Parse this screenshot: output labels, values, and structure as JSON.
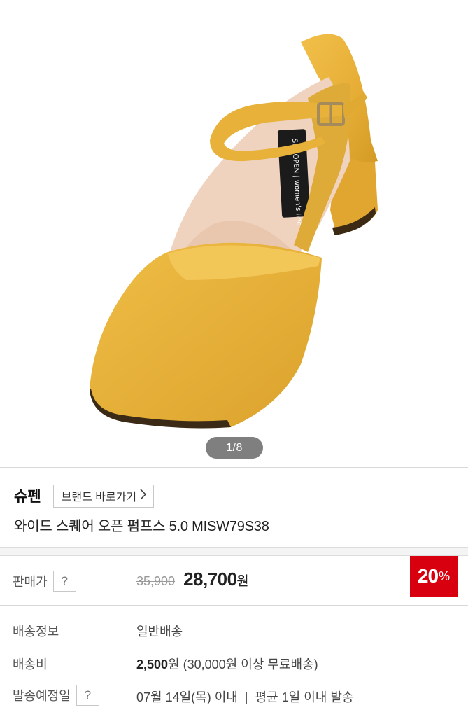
{
  "gallery": {
    "current": "1",
    "total": "/8",
    "image_label": "SHOOPEN | women's line"
  },
  "brand": {
    "name": "슈펜",
    "shortcut_label": "브랜드 바로가기",
    "shortcut_icon": "chevron-right-icon"
  },
  "product": {
    "name": "와이드 스퀘어 오픈 펌프스 5.0 MISW79S38"
  },
  "price": {
    "label": "판매가",
    "help": "?",
    "original": "35,900",
    "sale": "28,700",
    "unit": "원",
    "discount": "20",
    "discount_unit": "%"
  },
  "shipping": {
    "info_label": "배송정보",
    "info_value": "일반배송",
    "fee_label": "배송비",
    "fee_amount": "2,500",
    "fee_unit": "원",
    "fee_note": " (30,000원 이상 무료배송)",
    "eta_label": "발송예정일",
    "eta_help": "?",
    "eta_date": "07월 14일(목) 이내",
    "eta_sep": "|",
    "eta_avg": "평균 1일 이내 발송"
  },
  "colors": {
    "shoe": "#E8B23A",
    "discount_badge": "#D8000F"
  }
}
